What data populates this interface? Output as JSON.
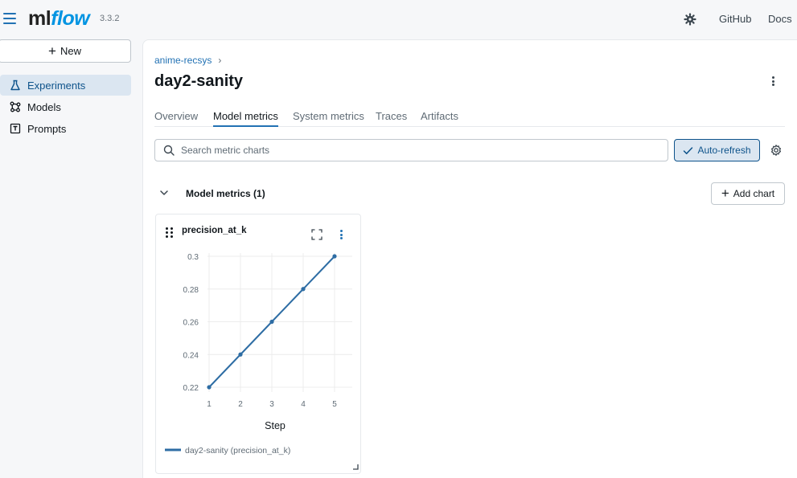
{
  "app": {
    "logo_ml": "ml",
    "logo_flow": "flow",
    "version": "3.3.2",
    "links": {
      "github": "GitHub",
      "docs": "Docs"
    }
  },
  "sidebar": {
    "new_label": "New",
    "items": [
      {
        "label": "Experiments",
        "icon": "beaker-icon",
        "active": true
      },
      {
        "label": "Models",
        "icon": "models-icon",
        "active": false
      },
      {
        "label": "Prompts",
        "icon": "prompts-icon",
        "active": false
      }
    ]
  },
  "header": {
    "breadcrumb": "anime-recsys",
    "title": "day2-sanity"
  },
  "tabs": [
    {
      "label": "Overview",
      "active": false
    },
    {
      "label": "Model metrics",
      "active": true
    },
    {
      "label": "System metrics",
      "active": false
    },
    {
      "label": "Traces",
      "active": false
    },
    {
      "label": "Artifacts",
      "active": false
    }
  ],
  "toolbar": {
    "search_placeholder": "Search metric charts",
    "autorefresh_label": "Auto-refresh"
  },
  "section": {
    "title": "Model metrics (1)",
    "add_chart_label": "Add chart"
  },
  "card": {
    "title": "precision_at_k"
  },
  "colors": {
    "accent": "#2272b4",
    "active_bg": "#dbe6f1",
    "series": "#2e6da4"
  },
  "chart_data": {
    "type": "line",
    "title": "precision_at_k",
    "xlabel": "Step",
    "ylabel": "",
    "x": [
      1,
      2,
      3,
      4,
      5
    ],
    "xticks": [
      "1",
      "2",
      "3",
      "4",
      "5"
    ],
    "yticks": [
      "0.22",
      "0.24",
      "0.26",
      "0.28",
      "0.3"
    ],
    "xlim": [
      1,
      5
    ],
    "ylim": [
      0.22,
      0.3
    ],
    "grid": true,
    "legend_position": "bottom",
    "series": [
      {
        "name": "day2-sanity (precision_at_k)",
        "values": [
          0.22,
          0.24,
          0.26,
          0.28,
          0.3
        ]
      }
    ]
  }
}
